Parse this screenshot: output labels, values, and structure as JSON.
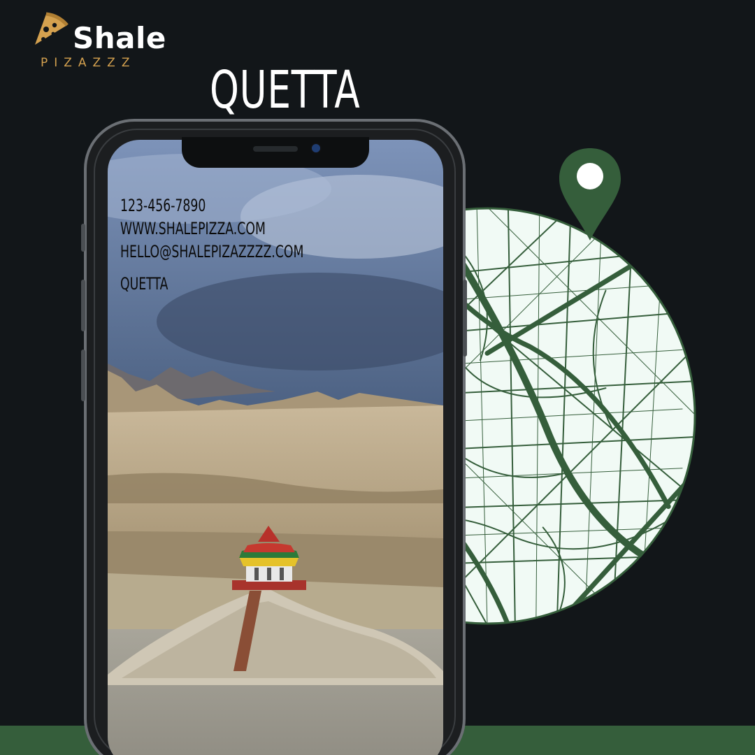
{
  "brand": {
    "name": "Shale",
    "tagline": "PIZAZZZ",
    "accent": "#d4a14f"
  },
  "page": {
    "title": "QUETTA",
    "background": "#121619",
    "band_color": "#355e3b"
  },
  "contact": {
    "phone": "123-456-7890",
    "website": "WWW.SHALEPIZZA.COM",
    "email": "HELLO@SHALEPIZAZZZZ.COM",
    "city": "QUETTA"
  },
  "map": {
    "land_color": "#f1faf5",
    "road_color": "#355e3b",
    "pin_icon": "map-pin-icon"
  }
}
